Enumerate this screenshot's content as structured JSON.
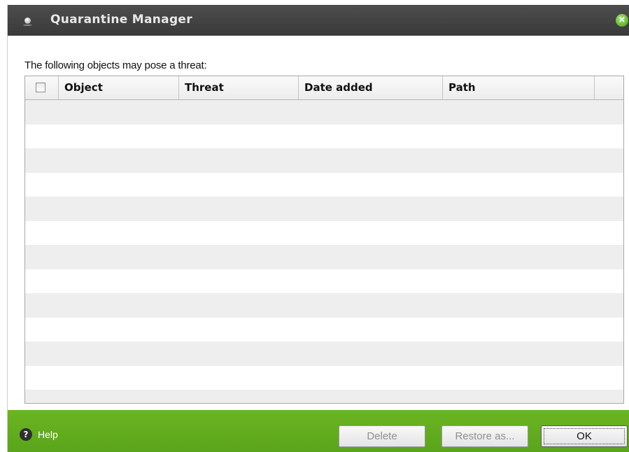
{
  "window": {
    "title": "Quarantine Manager",
    "close_icon": "close-icon"
  },
  "main": {
    "prompt": "The following objects may pose a threat:",
    "table": {
      "columns": [
        "",
        "Object",
        "Threat",
        "Date added",
        "Path",
        ""
      ],
      "rows": []
    }
  },
  "footer": {
    "help_label": "Help",
    "help_icon_glyph": "?",
    "buttons": {
      "delete": "Delete",
      "restore": "Restore as...",
      "ok": "OK"
    }
  },
  "colors": {
    "titlebar": "#3f3f3f",
    "footer": "#62ad1f",
    "accent": "#7bc943",
    "row_alt": "#eeeeee"
  }
}
